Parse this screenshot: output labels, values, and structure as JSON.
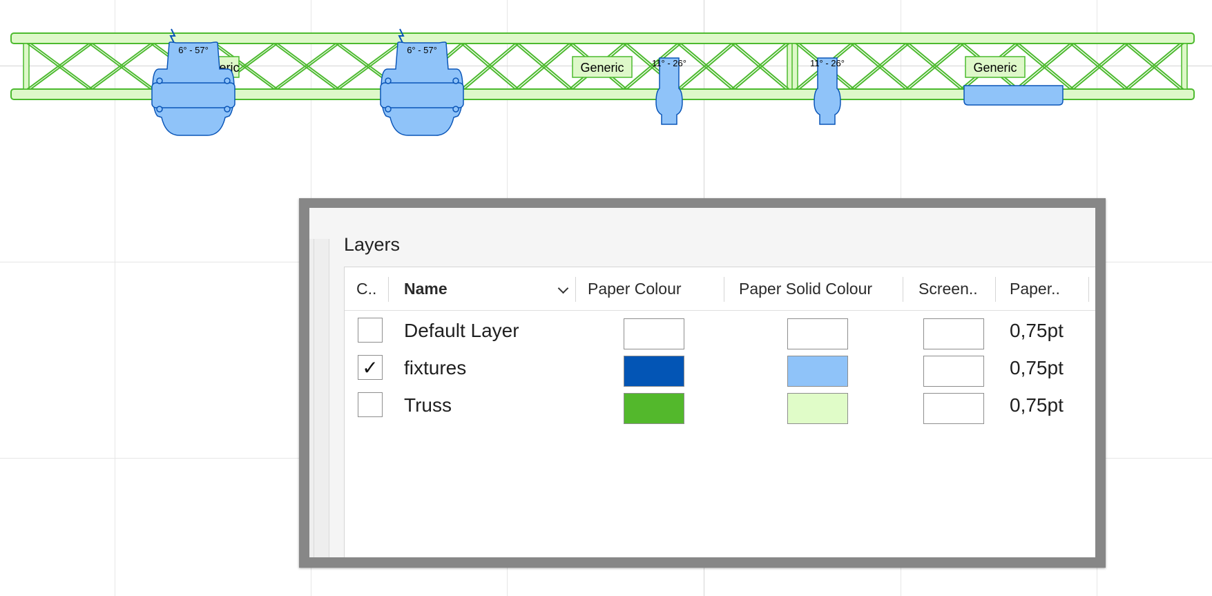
{
  "canvas": {
    "truss_label": "Generic",
    "fixtures": [
      {
        "kind": "moving-head",
        "beam_label": "6° - 57°"
      },
      {
        "kind": "moving-head",
        "beam_label": "6° - 57°"
      },
      {
        "kind": "profile-spot",
        "beam_label": "11° - 26°"
      },
      {
        "kind": "profile-spot",
        "beam_label": "11° - 26°"
      },
      {
        "kind": "led-bar",
        "beam_label": ""
      }
    ],
    "truss_colors": {
      "stroke": "#4cba2e",
      "fill": "#def8c9"
    },
    "fixture_colors": {
      "stroke": "#0a55b7",
      "fill": "#8fc3f9"
    }
  },
  "layers_panel": {
    "title": "Layers",
    "columns": {
      "check": "C..",
      "name": "Name",
      "paper_colour": "Paper Colour",
      "paper_solid_colour": "Paper Solid Colour",
      "screen": "Screen..",
      "paper": "Paper.."
    },
    "rows": [
      {
        "checked": false,
        "check_mark": "",
        "name": "Default Layer",
        "paper_colour": "#ffffff",
        "paper_solid_colour": "#ffffff",
        "screen_colour": "#ffffff",
        "paper_line_weight": "0,75pt"
      },
      {
        "checked": true,
        "check_mark": "✓",
        "name": "fixtures",
        "paper_colour": "#0355b5",
        "paper_solid_colour": "#8fc3f9",
        "screen_colour": "#ffffff",
        "paper_line_weight": "0,75pt"
      },
      {
        "checked": false,
        "check_mark": "",
        "name": "Truss",
        "paper_colour": "#53b82c",
        "paper_solid_colour": "#e0fcc8",
        "screen_colour": "#ffffff",
        "paper_line_weight": "0,75pt"
      }
    ]
  }
}
